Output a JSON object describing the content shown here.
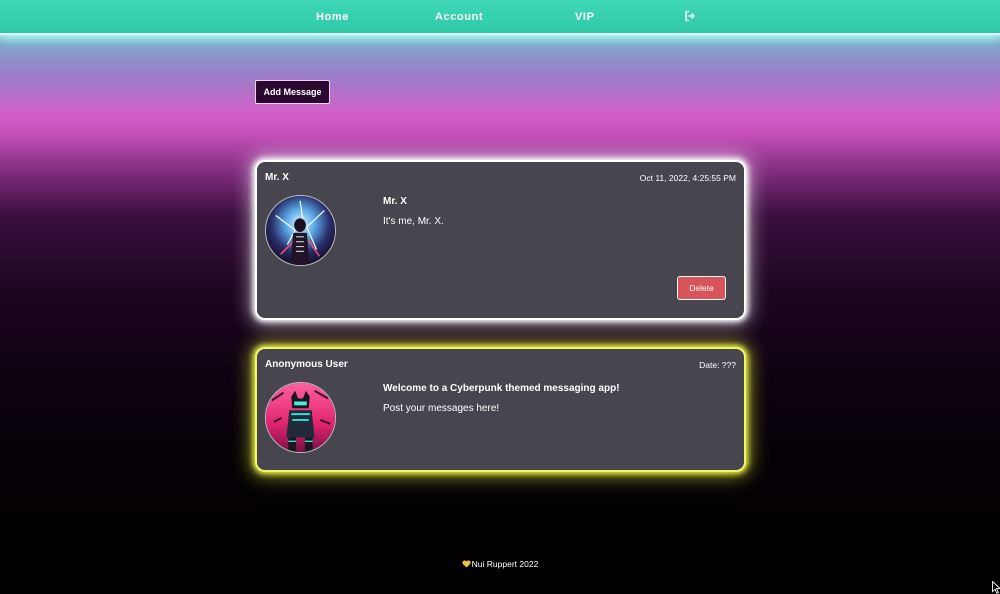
{
  "nav": {
    "home": "Home",
    "account": "Account",
    "vip": "VIP",
    "logout_icon": "logout-icon"
  },
  "actions": {
    "add_message": "Add Message"
  },
  "messages": [
    {
      "user": "Mr. X",
      "date": "Oct 11, 2022, 4:25:55 PM",
      "title": "Mr. X",
      "body": "It's me, Mr. X.",
      "delete_label": "Delete",
      "glow_color": "#ffffff",
      "avatar_icon": "cyberpunk-avatar-blue"
    },
    {
      "user": "Anonymous User",
      "date": "Date: ???",
      "title": "Welcome to a Cyberpunk themed messaging app!",
      "body": "Post your messages here!",
      "glow_color": "#eef24a",
      "avatar_icon": "cyberpunk-avatar-pink"
    }
  ],
  "footer": {
    "text": "Nui Ruppert 2022",
    "icon": "heart-icon"
  },
  "colors": {
    "nav_bg": "#35cfae",
    "card_bg": "#47464f",
    "delete_bg": "#d9535b",
    "add_btn_bg": "#2a0830"
  }
}
